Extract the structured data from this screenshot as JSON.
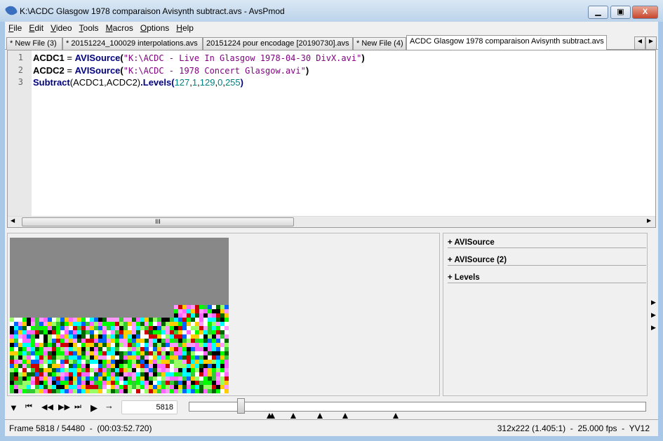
{
  "window": {
    "title": "K:\\ACDC Glasgow 1978 comparaison Avisynth subtract.avs - AvsPmod",
    "minimize": "▁",
    "maximize": "▣",
    "close": "X"
  },
  "menu": [
    {
      "label": "File",
      "key": "F",
      "rest": "ile"
    },
    {
      "label": "Edit",
      "key": "E",
      "rest": "dit"
    },
    {
      "label": "Video",
      "key": "V",
      "rest": "ideo"
    },
    {
      "label": "Tools",
      "key": "T",
      "rest": "ools"
    },
    {
      "label": "Macros",
      "key": "M",
      "rest": "acros"
    },
    {
      "label": "Options",
      "key": "O",
      "rest": "ptions"
    },
    {
      "label": "Help",
      "key": "H",
      "rest": "elp"
    }
  ],
  "tabs": [
    {
      "label": "* New File (3)"
    },
    {
      "label": "* 20151224_100029 interpolations.avs"
    },
    {
      "label": "20151224 pour encodage [20190730].avs"
    },
    {
      "label": "* New File (4)"
    },
    {
      "label": "ACDC Glasgow 1978 comparaison Avisynth subtract.avs",
      "active": true
    }
  ],
  "editor": {
    "lines": [
      {
        "n": "1",
        "var": "ACDC1",
        "eq": " = ",
        "fn": "AVISource",
        "open": "(",
        "str": "\"K:\\ACDC - Live In Glasgow 1978-04-30 DivX.avi\"",
        "close": ")"
      },
      {
        "n": "2",
        "var": "ACDC2",
        "eq": " = ",
        "fn": "AVISource",
        "open": "(",
        "str": "\"K:\\ACDC - 1978 Concert Glasgow.avi\"",
        "close": ")"
      },
      {
        "n": "3",
        "fn1": "Subtract",
        "args": "(ACDC1,ACDC2)",
        "fn2": ".Levels",
        "open": "(",
        "nums": [
          "127",
          "1",
          "129",
          "0",
          "255"
        ],
        "close": ")"
      }
    ],
    "scroll_grip": "III"
  },
  "filters": [
    {
      "label": "+ AVISource"
    },
    {
      "label": "+ AVISource (2)"
    },
    {
      "label": "+ Levels"
    }
  ],
  "playback": {
    "frame_input": "5818",
    "position_fraction": 0.1068,
    "bookmarks_icon": "triangle-up"
  },
  "status": {
    "left": "Frame 5818 / 54480  -  (00:03:52.720)",
    "right": "312x222 (1.405:1)  -  25.000 fps  -  YV12"
  }
}
